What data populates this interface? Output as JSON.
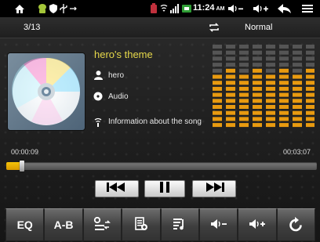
{
  "status_bar": {
    "time": "11:24",
    "time_suffix": "AM",
    "icons": [
      "home-icon",
      "android-icon",
      "shield-icon",
      "usb-icon",
      "battery-low-icon",
      "wifi-icon",
      "signal-icon",
      "alert-icon",
      "volume-down-icon",
      "volume-up-icon",
      "back-icon",
      "menu-icon"
    ]
  },
  "player": {
    "track_count": "3/13",
    "play_mode": "Normal",
    "title": "hero's theme",
    "artist": "hero",
    "album": "Audio",
    "info": "Information about the song",
    "elapsed": "00:00:09",
    "duration": "00:03:07",
    "progress_fraction": 0.05
  },
  "controls": [
    "previous-button",
    "pause-button",
    "next-button"
  ],
  "bottom_bar": {
    "eq_label": "EQ",
    "ab_label": "A-B",
    "buttons": [
      "eq-button",
      "ab-repeat-button",
      "play-order-button",
      "playlist-button",
      "lyrics-button",
      "volume-down-button",
      "volume-up-button",
      "return-button"
    ]
  },
  "colors": {
    "accent": "#f4c30a",
    "title": "#e6d84a",
    "eq_bar_lit": "#e89a10",
    "eq_bar_dim": "#555555"
  }
}
